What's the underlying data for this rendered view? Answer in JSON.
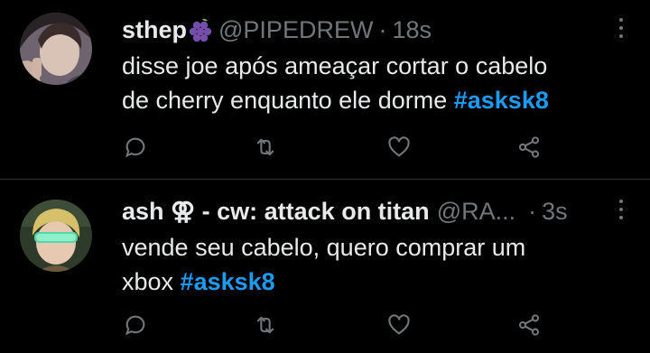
{
  "colors": {
    "background": "#000000",
    "text": "#e7e9ea",
    "muted": "#71767b",
    "link": "#1d9bf0",
    "divider": "#2f3336"
  },
  "tweets": [
    {
      "display_name": "sthep",
      "name_emoji": "grapes-emoji",
      "handle": "@PIPEDREW",
      "separator": "·",
      "time": "18s",
      "text_lines": [
        "disse joe após ameaçar cortar o cabelo",
        "de cherry enquanto ele dorme "
      ],
      "hashtag": "#asksk8",
      "actions": [
        "reply-icon",
        "retweet-icon",
        "like-icon",
        "share-icon"
      ]
    },
    {
      "display_name": "ash ⚢ - cw: attack on titan",
      "handle": "@RA...",
      "separator": "·",
      "time": "3s",
      "text_lines": [
        "vende seu cabelo, quero comprar um",
        "xbox "
      ],
      "hashtag": "#asksk8",
      "actions": [
        "reply-icon",
        "retweet-icon",
        "like-icon",
        "share-icon"
      ]
    }
  ]
}
